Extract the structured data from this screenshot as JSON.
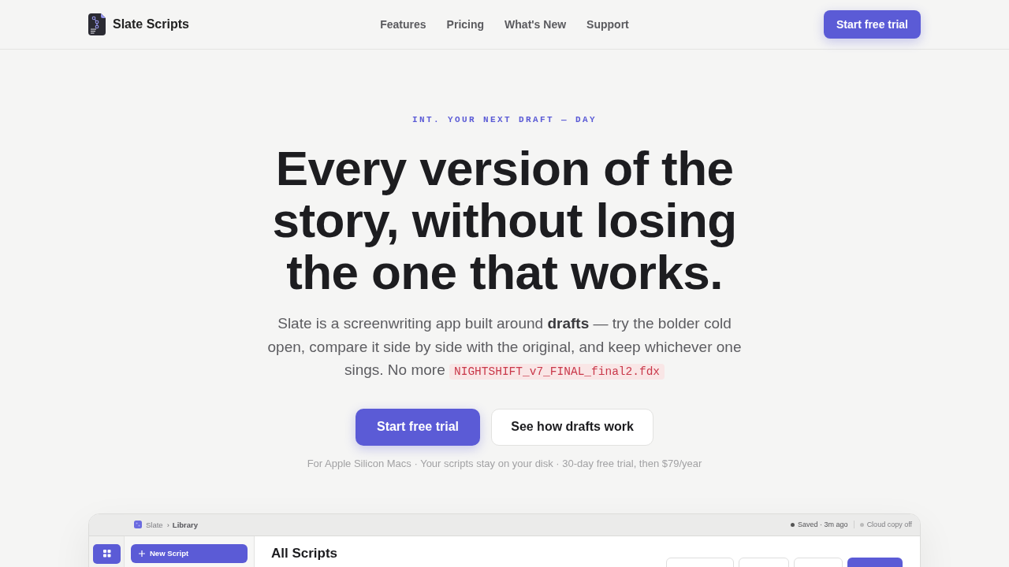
{
  "nav": {
    "brand": "Slate Scripts",
    "links": [
      "Features",
      "Pricing",
      "What's New",
      "Support"
    ],
    "cta": "Start free trial"
  },
  "hero": {
    "eyebrow": "INT. YOUR NEXT DRAFT — DAY",
    "title": "Every version of the story, without losing the one that works.",
    "description": "Slate is a screenwriting app built around **drafts** — try the bolder cold open, compare it side by side with the original, and keep whichever one sings. No more",
    "file_name": "NIGHTSHIFT_v7_FINAL_final2.fdx",
    "buttons": [
      {
        "label": "Start free trial",
        "kind": "primary"
      },
      {
        "label": "See how drafts work",
        "kind": "secondary"
      }
    ],
    "note": "For Apple Silicon Macs · Your scripts stay on your disk · 30-day free trial, then $79/year"
  },
  "app_preview": {
    "breadcrumb": [
      "Slate",
      "Library"
    ],
    "separator": "›",
    "status": [
      {
        "label": "Saved · 3m ago",
        "color": "#555555"
      },
      {
        "label": "Cloud copy off",
        "color": "#bbbbbb"
      }
    ],
    "new_button": "New Script",
    "heading": "All Scripts",
    "toolbar_buttons": [
      {
        "kind": "secondary"
      },
      {
        "kind": "secondary"
      },
      {
        "kind": "secondary"
      },
      {
        "kind": "primary"
      }
    ]
  }
}
